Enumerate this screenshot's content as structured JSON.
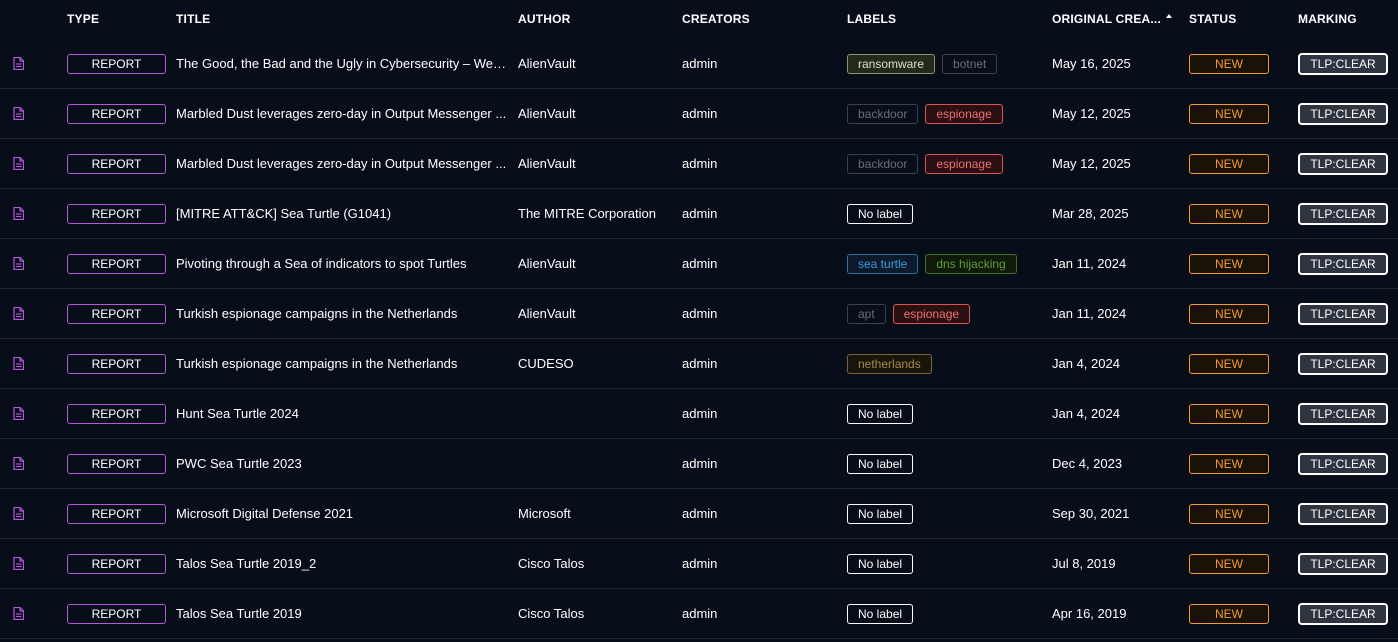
{
  "header": {
    "type": "TYPE",
    "title": "TITLE",
    "author": "AUTHOR",
    "creators": "CREATORS",
    "labels": "LABELS",
    "original_creation": "ORIGINAL CREA...",
    "status": "STATUS",
    "marking": "MARKING"
  },
  "icons": {
    "row_icon": "file-document-icon",
    "sort_icon": "sort-ascending-icon"
  },
  "colors": {
    "type_border": "#b35ad8",
    "status": "#f39a2c",
    "marking_bg": "#2e3440"
  },
  "rows": [
    {
      "type": "REPORT",
      "title": "The Good, the Bad and the Ugly in Cybersecurity – Wee...",
      "author": "AlienVault",
      "creator": "admin",
      "labels": [
        {
          "text": "ransomware",
          "color": "#d9e3c6",
          "border": "#8a9774",
          "bg": "#23291b"
        },
        {
          "text": "botnet",
          "color": "#6a6e74",
          "border": "#3e4248",
          "bg": "transparent"
        }
      ],
      "date": "May 16, 2025",
      "status": "NEW",
      "marking": "TLP:CLEAR"
    },
    {
      "type": "REPORT",
      "title": "Marbled Dust leverages zero-day in Output Messenger ...",
      "author": "AlienVault",
      "creator": "admin",
      "labels": [
        {
          "text": "backdoor",
          "color": "#6a6e74",
          "border": "#3e4248",
          "bg": "transparent"
        },
        {
          "text": "espionage",
          "color": "#f07070",
          "border": "#d9534f",
          "bg": "#2a1013"
        }
      ],
      "date": "May 12, 2025",
      "status": "NEW",
      "marking": "TLP:CLEAR"
    },
    {
      "type": "REPORT",
      "title": "Marbled Dust leverages zero-day in Output Messenger ...",
      "author": "AlienVault",
      "creator": "admin",
      "labels": [
        {
          "text": "backdoor",
          "color": "#6a6e74",
          "border": "#3e4248",
          "bg": "transparent"
        },
        {
          "text": "espionage",
          "color": "#f07070",
          "border": "#d9534f",
          "bg": "#2a1013"
        }
      ],
      "date": "May 12, 2025",
      "status": "NEW",
      "marking": "TLP:CLEAR"
    },
    {
      "type": "REPORT",
      "title": "[MITRE ATT&CK] Sea Turtle (G1041)",
      "author": "The MITRE Corporation",
      "creator": "admin",
      "labels": [
        {
          "text": "No label",
          "color": "#ffffff",
          "border": "#ffffff",
          "bg": "transparent"
        }
      ],
      "date": "Mar 28, 2025",
      "status": "NEW",
      "marking": "TLP:CLEAR"
    },
    {
      "type": "REPORT",
      "title": "Pivoting through a Sea of indicators to spot Turtles",
      "author": "AlienVault",
      "creator": "admin",
      "labels": [
        {
          "text": "sea turtle",
          "color": "#3d9be0",
          "border": "#2a6fa8",
          "bg": "#0c1a2b"
        },
        {
          "text": "dns hijacking",
          "color": "#5f9e3a",
          "border": "#3f6d25",
          "bg": "#0f1a0b"
        }
      ],
      "date": "Jan 11, 2024",
      "status": "NEW",
      "marking": "TLP:CLEAR"
    },
    {
      "type": "REPORT",
      "title": "Turkish espionage campaigns in the Netherlands",
      "author": "AlienVault",
      "creator": "admin",
      "labels": [
        {
          "text": "apt",
          "color": "#6a6e74",
          "border": "#3e4248",
          "bg": "transparent"
        },
        {
          "text": "espionage",
          "color": "#f07070",
          "border": "#d9534f",
          "bg": "#2a1013"
        }
      ],
      "date": "Jan 11, 2024",
      "status": "NEW",
      "marking": "TLP:CLEAR"
    },
    {
      "type": "REPORT",
      "title": "Turkish espionage campaigns in the Netherlands",
      "author": "CUDESO",
      "creator": "admin",
      "labels": [
        {
          "text": "netherlands",
          "color": "#a8894a",
          "border": "#7a6434",
          "bg": "#1a150a"
        }
      ],
      "date": "Jan 4, 2024",
      "status": "NEW",
      "marking": "TLP:CLEAR"
    },
    {
      "type": "REPORT",
      "title": "Hunt Sea Turtle 2024",
      "author": "",
      "creator": "admin",
      "labels": [
        {
          "text": "No label",
          "color": "#ffffff",
          "border": "#ffffff",
          "bg": "transparent"
        }
      ],
      "date": "Jan 4, 2024",
      "status": "NEW",
      "marking": "TLP:CLEAR"
    },
    {
      "type": "REPORT",
      "title": "PWC Sea Turtle 2023",
      "author": "",
      "creator": "admin",
      "labels": [
        {
          "text": "No label",
          "color": "#ffffff",
          "border": "#ffffff",
          "bg": "transparent"
        }
      ],
      "date": "Dec 4, 2023",
      "status": "NEW",
      "marking": "TLP:CLEAR"
    },
    {
      "type": "REPORT",
      "title": "Microsoft Digital Defense 2021",
      "author": "Microsoft",
      "creator": "admin",
      "labels": [
        {
          "text": "No label",
          "color": "#ffffff",
          "border": "#ffffff",
          "bg": "transparent"
        }
      ],
      "date": "Sep 30, 2021",
      "status": "NEW",
      "marking": "TLP:CLEAR"
    },
    {
      "type": "REPORT",
      "title": "Talos Sea Turtle 2019_2",
      "author": "Cisco Talos",
      "creator": "admin",
      "labels": [
        {
          "text": "No label",
          "color": "#ffffff",
          "border": "#ffffff",
          "bg": "transparent"
        }
      ],
      "date": "Jul 8, 2019",
      "status": "NEW",
      "marking": "TLP:CLEAR"
    },
    {
      "type": "REPORT",
      "title": "Talos Sea Turtle 2019",
      "author": "Cisco Talos",
      "creator": "admin",
      "labels": [
        {
          "text": "No label",
          "color": "#ffffff",
          "border": "#ffffff",
          "bg": "transparent"
        }
      ],
      "date": "Apr 16, 2019",
      "status": "NEW",
      "marking": "TLP:CLEAR"
    }
  ]
}
